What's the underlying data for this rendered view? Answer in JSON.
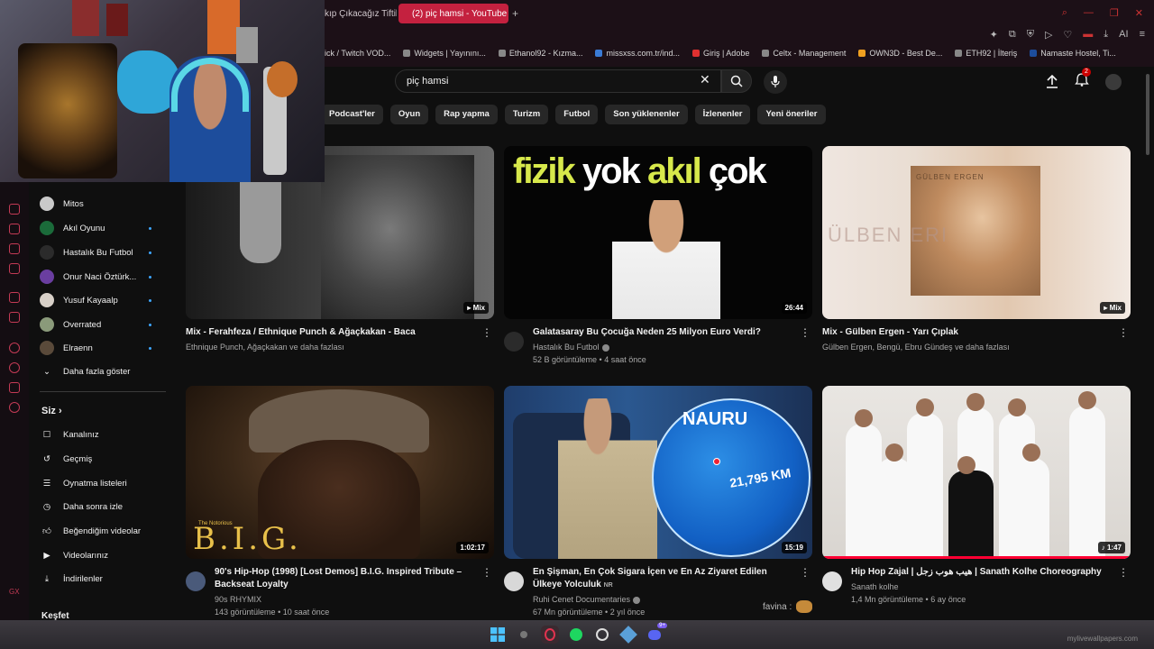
{
  "browser": {
    "tabs": [
      {
        "label": "kıp Çıkacağız Tiftik",
        "active": false
      },
      {
        "label": "(2) piç hamsi - YouTube",
        "active": true
      }
    ],
    "new_tab_label": "+",
    "bookmarks": [
      "ick / Twitch VOD...",
      "Widgets | Yayınını...",
      "Ethanol92 - Kızma...",
      "missxss.com.tr/ind...",
      "Giriş | Adobe",
      "Celtx - Management",
      "OWN3D - Best De...",
      "ETH92 | İlteriş",
      "Namaste Hostel, Ti..."
    ],
    "ai_label": "AI"
  },
  "youtube": {
    "search": {
      "query": "piç hamsi"
    },
    "notifications_count": "2",
    "chips": [
      "Podcast'ler",
      "Oyun",
      "Rap yapma",
      "Turizm",
      "Futbol",
      "Son yüklenenler",
      "İzlenenler",
      "Yeni öneriler"
    ],
    "subscriptions": [
      {
        "name": "Mitos",
        "live": false,
        "color": "#c9c9c9"
      },
      {
        "name": "Akıl Oyunu",
        "live": true,
        "color": "#1b6b3a"
      },
      {
        "name": "Hastalık Bu Futbol",
        "live": true,
        "color": "#2b2b2b"
      },
      {
        "name": "Onur Naci Öztürk...",
        "live": true,
        "color": "#6a3ea0"
      },
      {
        "name": "Yusuf Kayaalp",
        "live": true,
        "color": "#d8d0c8"
      },
      {
        "name": "Overrated",
        "live": true,
        "color": "#8a9a7a"
      },
      {
        "name": "Elraenn",
        "live": true,
        "color": "#5a4a3a"
      }
    ],
    "show_more": "Daha fazla göster",
    "you_section": {
      "heading": "Siz",
      "items": [
        "Kanalınız",
        "Geçmiş",
        "Oynatma listeleri",
        "Daha sonra izle",
        "Beğendiğim videolar",
        "Videolarınız",
        "İndirilenler"
      ]
    },
    "explore_heading": "Keşfet",
    "videos": [
      {
        "title": "Mix - Ferahfeza / Ethnique Punch & Ağaçkakan - Baca",
        "channel": "Ethnique Punch, Ağaçkakan ve daha fazlası",
        "views": "",
        "age": "",
        "badge": "Mix",
        "avatar_color": ""
      },
      {
        "title": "Galatasaray Bu Çocuğa Neden 25 Milyon Euro Verdi?",
        "channel": "Hastalık Bu Futbol",
        "views": "52 B görüntüleme",
        "age": "4 saat önce",
        "badge": "26:44",
        "avatar_color": "#2b2b2b",
        "thumb_text_1": "fizik",
        "thumb_text_2": "yok",
        "thumb_text_3": "akıl",
        "thumb_text_4": "çok"
      },
      {
        "title": "Mix - Gülben Ergen - Yarı Çıplak",
        "channel": "Gülben Ergen, Bengü, Ebru Gündeş ve daha fazlası",
        "views": "",
        "age": "",
        "badge": "Mix",
        "avatar_color": "",
        "thumb_text": "GÜLBEN ERGEN",
        "thumb_ghost": "ÜLBEN ERI"
      },
      {
        "title": "90's Hip-Hop (1998) [Lost Demos] B.I.G. Inspired Tribute – Backseat Loyalty",
        "channel": "90s RHYMIX",
        "views": "143 görüntüleme",
        "age": "10 saat önce",
        "badge": "1:02:17",
        "avatar_color": "#4a5a7a",
        "thumb_text": "B.I.G.",
        "thumb_sub": "The Notorious"
      },
      {
        "title": "En Şişman, En Çok Sigara İçen ve En Az Ziyaret Edilen Ülkeye Yolculuk",
        "title_suffix": "NR",
        "channel": "Ruhi Cenet Documentaries",
        "views": "67 Mn görüntüleme",
        "age": "2 yıl önce",
        "badge": "15:19",
        "avatar_color": "#d8d8d8",
        "thumb_text": "NAURU",
        "thumb_distance": "21,795 KM"
      },
      {
        "title": "Hip Hop Zajal | هيب هوب زجل | Sanath Kolhe Choreography",
        "channel": "Sanath kolhe",
        "views": "1,4 Mn görüntüleme",
        "age": "6 ay önce",
        "badge": "♪ 1:47",
        "avatar_color": "#e0e0e0"
      }
    ],
    "chat_overlay": "favina :"
  },
  "taskbar": {
    "watermark": "mylivewallpapers.com",
    "discord_badge": "9+"
  },
  "colors": {
    "accent": "#c4213f",
    "youtube_red": "#ff0033",
    "link_blue": "#3ea6ff",
    "bg": "#0f0f0f"
  }
}
